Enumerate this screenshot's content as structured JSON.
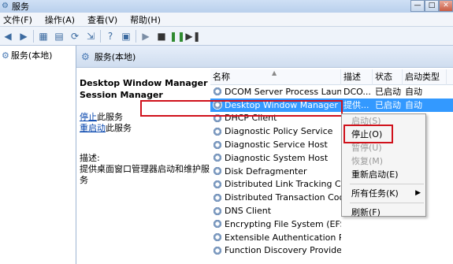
{
  "window": {
    "title": "服务",
    "minimize": "—",
    "maximize": "□",
    "close": "✕"
  },
  "menu": [
    "文件(F)",
    "操作(A)",
    "查看(V)",
    "帮助(H)"
  ],
  "toolbar_icons": [
    "back-icon",
    "forward-icon",
    "console-tree-icon",
    "show-hide-icon",
    "refresh-icon",
    "export-icon",
    "help-icon",
    "properties-icon",
    "start-service-icon",
    "stop-service-icon",
    "pause-service-icon",
    "restart-service-icon"
  ],
  "left": {
    "tree_item": "服务(本地)"
  },
  "header": {
    "title": "服务(本地)"
  },
  "detail": {
    "service_name": "Desktop Window Manager Session Manager",
    "stop_link": "停止",
    "stop_suffix": "此服务",
    "restart_link": "重启动",
    "restart_suffix": "此服务",
    "desc_label": "描述:",
    "desc_text": "提供桌面窗口管理器启动和维护服务"
  },
  "columns": {
    "name": "名称",
    "desc": "描述",
    "state": "状态",
    "start": "启动类型"
  },
  "rows": [
    {
      "name": "DCOM Server Process Launcher",
      "desc": "DCO...",
      "state": "已启动",
      "start": "自动"
    },
    {
      "name": "Desktop Window Manager Se...",
      "desc": "提供...",
      "state": "已启动",
      "start": "自动"
    },
    {
      "name": "DHCP Client",
      "desc": "",
      "state": "",
      "start": ""
    },
    {
      "name": "Diagnostic Policy Service",
      "desc": "",
      "state": "",
      "start": ""
    },
    {
      "name": "Diagnostic Service Host",
      "desc": "",
      "state": "",
      "start": ""
    },
    {
      "name": "Diagnostic System Host",
      "desc": "",
      "state": "",
      "start": ""
    },
    {
      "name": "Disk Defragmenter",
      "desc": "",
      "state": "",
      "start": ""
    },
    {
      "name": "Distributed Link Tracking Clie",
      "desc": "",
      "state": "",
      "start": ""
    },
    {
      "name": "Distributed Transaction Coord",
      "desc": "",
      "state": "",
      "start": ""
    },
    {
      "name": "DNS Client",
      "desc": "",
      "state": "",
      "start": ""
    },
    {
      "name": "Encrypting File System (EFS)",
      "desc": "",
      "state": "",
      "start": ""
    },
    {
      "name": "Extensible Authentication Pr",
      "desc": "",
      "state": "",
      "start": ""
    },
    {
      "name": "Function Discovery Provider",
      "desc": "",
      "state": "",
      "start": ""
    }
  ],
  "context_menu": {
    "start": "启动(S)",
    "stop": "停止(O)",
    "pause": "暂停(U)",
    "resume": "恢复(M)",
    "restart": "重新启动(E)",
    "all_tasks": "所有任务(K)",
    "refresh": "刷新(F)"
  },
  "colors": {
    "selection": "#3399ff",
    "highlight_box": "#d0111b"
  }
}
